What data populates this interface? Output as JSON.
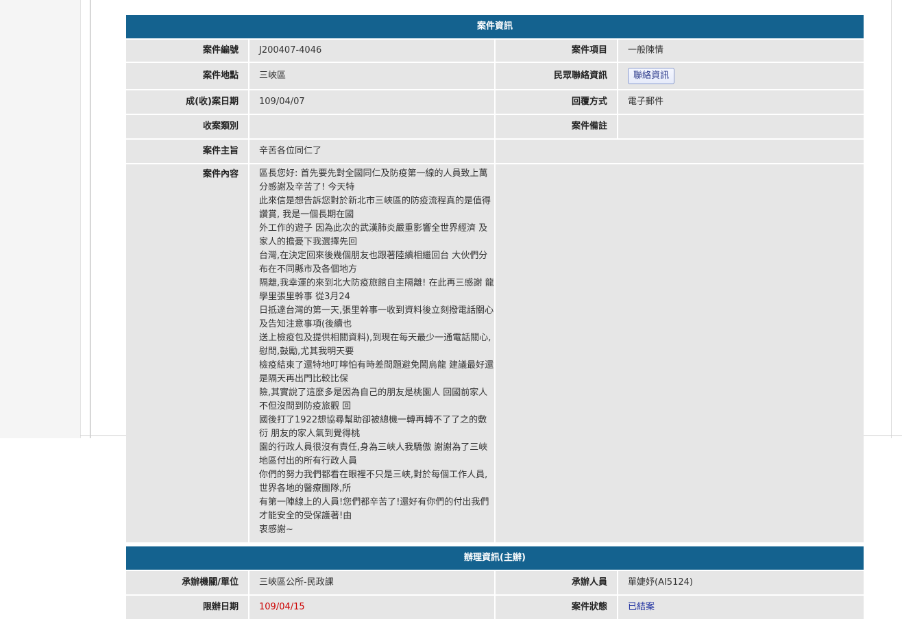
{
  "colors": {
    "header_bg": "#14628f",
    "row_bg": "#e6e6e6",
    "deadline_red": "#cc0000",
    "status_blue": "#1a2c9f"
  },
  "case_info": {
    "section_title": "案件資訊",
    "case_no_label": "案件編號",
    "case_no": "J200407-4046",
    "case_item_label": "案件項目",
    "case_item": "一般陳情",
    "location_label": "案件地點",
    "location": "三峽區",
    "contact_label": "民眾聯絡資訊",
    "contact_button": "聯絡資訊",
    "date_label": "成(收)案日期",
    "date": "109/04/07",
    "reply_label": "回覆方式",
    "reply": "電子郵件",
    "category_label": "收案類別",
    "category": "",
    "note_label": "案件備註",
    "note": "",
    "subject_label": "案件主旨",
    "subject": "辛苦各位同仁了",
    "content_label": "案件內容",
    "content": "區長您好: 首先要先對全國同仁及防疫第一線的人員致上萬分感謝及辛苦了! 今天特\n此來信是想告訴您對於新北市三峽區的防疫流程真的是值得讚賞, 我是一個長期在國\n外工作的遊子 因為此次的武漢肺炎嚴重影響全世界經濟 及家人的擔憂下我選擇先回\n台灣,在決定回來後幾個朋友也跟著陸續相繼回台 大伙們分布在不同縣市及各個地方\n隔離,我幸運的來到北大防疫旅館自主隔離! 在此再三感謝 龍學里張里幹事 從3月24\n日抵達台灣的第一天,張里幹事一收到資料後立刻撥電話關心及告知注意事項(後續也\n送上檢疫包及提供相關資料),到現在每天最少一通電話關心,慰問,鼓勵,尤其我明天要\n檢疫結束了還特地叮嚀怕有時差問題避免鬧烏龍 建議最好還是隔天再出門比較比保\n險,其實說了這麼多是因為自己的朋友是桃園人 回國前家人不但沒問到防疫旅觀 回\n國後打了1922想協尋幫助卻被總機一轉再轉不了了之的敷衍 朋友的家人氣到覺得桃\n園的行政人員很沒有責任,身為三峽人我驕傲 謝謝為了三峽地區付出的所有行政人員\n你們的努力我們都看在眼裡不只是三峽,對於每個工作人員,世界各地的醫療團隊,所\n有第一陣線上的人員!您們都辛苦了!還好有你們的付出我們才能安全的受保護著!由\n衷感謝~"
  },
  "handling_info": {
    "section_title": "辦理資訊(主辦)",
    "agency_label": "承辦機關/單位",
    "agency": "三峽區公所-民政課",
    "officer_label": "承辦人員",
    "officer": "單婕妤(AI5124)",
    "deadline_label": "限辦日期",
    "deadline": "109/04/15",
    "status_label": "案件狀態",
    "status": "已結案"
  }
}
